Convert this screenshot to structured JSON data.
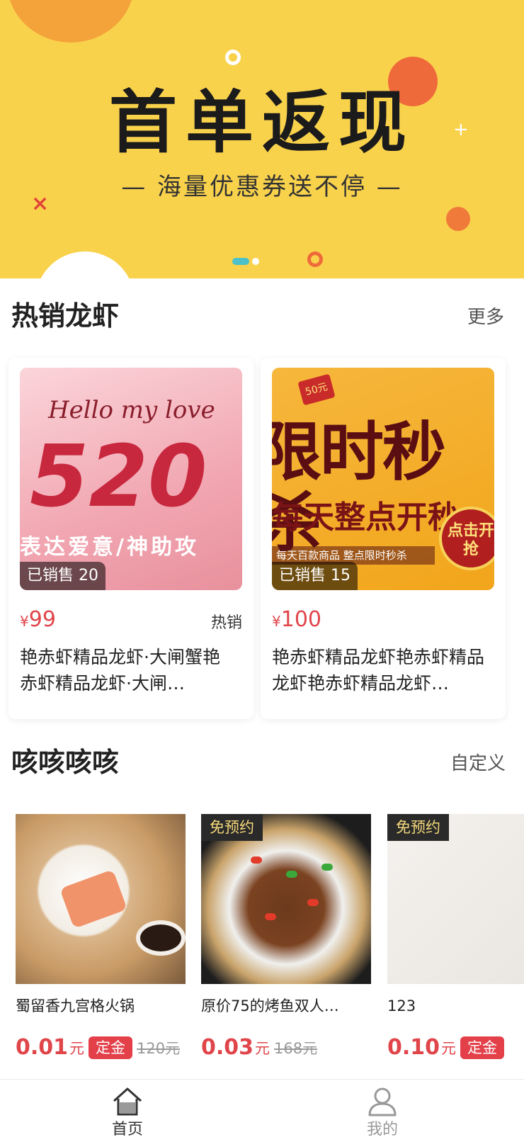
{
  "banner": {
    "headline": "首单返现",
    "subline": "— 海量优惠券送不停 —",
    "slide_count": 2,
    "active_slide": 1
  },
  "hot_section": {
    "title": "热销龙虾",
    "more": "更多",
    "cards": [
      {
        "image_text": {
          "script": "Hello my love",
          "big": "520",
          "phrase": "表达爱意/神助攻"
        },
        "sold": "已销售 20",
        "currency": "¥",
        "price": "99",
        "tag": "热销",
        "name": "艳赤虾精品龙虾·大闸蟹艳赤虾精品龙虾·大闸…"
      },
      {
        "image_text": {
          "badge": "50元",
          "big": "限时秒杀",
          "mid": "每天整点开秒",
          "strip": "每天百款商品 整点限时秒杀",
          "button": "点击开抢"
        },
        "sold": "已销售 15",
        "currency": "¥",
        "price": "100",
        "tag": "",
        "name": "艳赤虾精品龙虾艳赤虾精品龙虾艳赤虾精品龙虾…"
      }
    ]
  },
  "deal_section": {
    "title": "咳咳咳咳",
    "more": "自定义",
    "cards": [
      {
        "badge": "",
        "name": "蜀留香九宫格火锅",
        "price": "0.01",
        "unit": "元",
        "deposit": "定金",
        "original": "120元"
      },
      {
        "badge": "免预约",
        "name": "原价75的烤鱼双人…",
        "price": "0.03",
        "unit": "元",
        "deposit": "",
        "original": "168元"
      },
      {
        "badge": "免预约",
        "name": "123",
        "price": "0.10",
        "unit": "元",
        "deposit": "定金",
        "original": ""
      }
    ]
  },
  "tabbar": {
    "items": [
      {
        "label": "首页",
        "icon": "home-icon",
        "active": true,
        "color": "#333333"
      },
      {
        "label": "我的",
        "icon": "user-icon",
        "active": false,
        "color": "#999999"
      }
    ]
  },
  "colors": {
    "banner_bg": "#f9d24c",
    "price_red": "#e0454a",
    "deposit_red": "#e3404a",
    "badge_gold": "#f5d97a"
  }
}
